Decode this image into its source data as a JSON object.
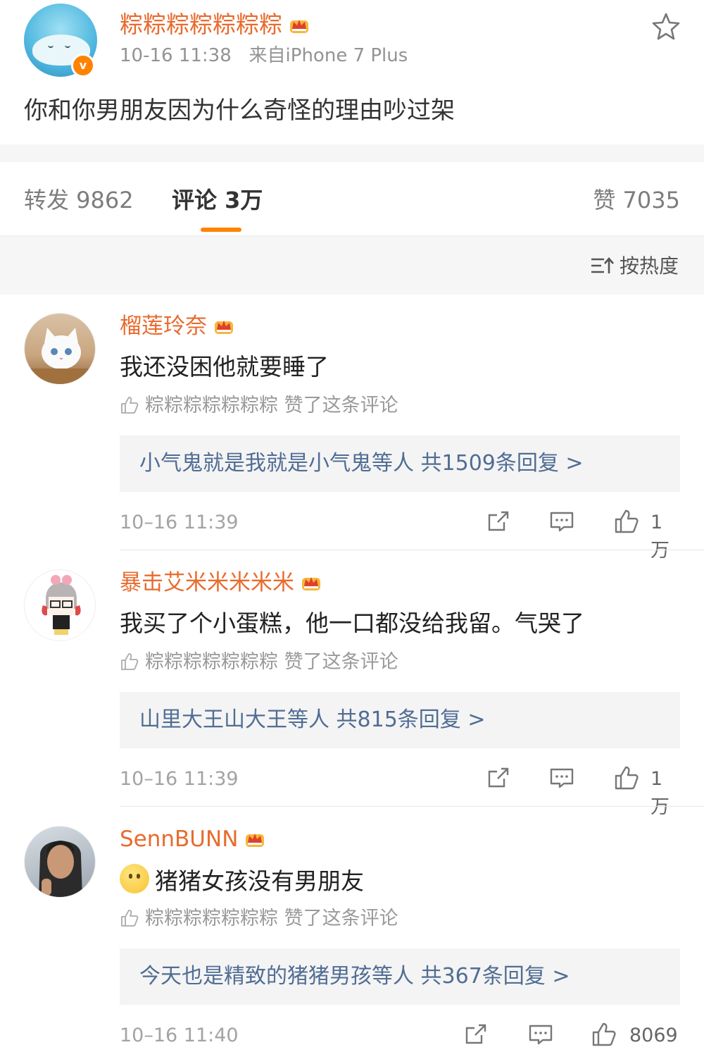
{
  "post": {
    "author": "粽粽粽粽粽粽粽",
    "verified_badge": "v",
    "time": "10-16 11:38",
    "source": "来自iPhone 7 Plus",
    "text": "你和你男朋友因为什么奇怪的理由吵过架"
  },
  "tabs": {
    "repost": "转发 9862",
    "comment": "评论 3万",
    "like": "赞 7035"
  },
  "sort_label": "按热度",
  "comments": [
    {
      "name": "榴莲玲奈",
      "text": "我还没困他就要睡了",
      "liked_by": "粽粽粽粽粽粽粽 赞了这条评论",
      "replies": "小气鬼就是我就是小气鬼等人  共1509条回复 >",
      "time": "10–16 11:39",
      "likes": "1万"
    },
    {
      "name": "暴击艾米米米米米",
      "text": "我买了个小蛋糕，他一口都没给我留。气哭了",
      "liked_by": "粽粽粽粽粽粽粽 赞了这条评论",
      "replies": "山里大王山大王等人  共815条回复 >",
      "time": "10–16 11:39",
      "likes": "1万"
    },
    {
      "name": "SennBUNN",
      "text": "猪猪女孩没有男朋友",
      "liked_by": "粽粽粽粽粽粽粽 赞了这条评论",
      "replies": "今天也是精致的猪猪男孩等人  共367条回复 >",
      "time": "10–16 11:40",
      "likes": "8069"
    }
  ],
  "icons": {
    "star": "star-icon",
    "crown": "crown-icon",
    "sort": "sort-icon",
    "share": "share-icon",
    "reply": "comment-icon",
    "like": "thumbs-up-icon"
  },
  "colors": {
    "username": "#e86b2e",
    "accent": "#ff8200",
    "reply_link": "#506d94"
  }
}
